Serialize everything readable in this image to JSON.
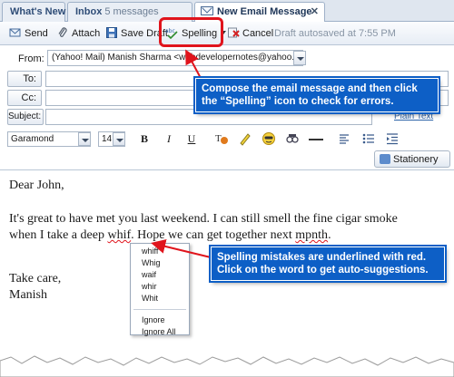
{
  "tabs": [
    {
      "label": "What's New"
    },
    {
      "label": "Inbox",
      "badge": "5 messages"
    },
    {
      "label": "New Email Message"
    }
  ],
  "toolbar": {
    "send": "Send",
    "attach": "Attach",
    "save_draft": "Save Draft",
    "spelling": "Spelling",
    "cancel": "Cancel",
    "draft_status": "Draft autosaved at 7:55 PM"
  },
  "header": {
    "from_label": "From:",
    "from_value": "(Yahoo! Mail) Manish Sharma <webdevelopernotes@yahoo.com>",
    "to_label": "To:",
    "cc_label": "Cc:",
    "subject_label": "Subject:",
    "plain_text_link": "Plain Text"
  },
  "format_toolbar": {
    "font": "Garamond",
    "size": "14",
    "bold": "B",
    "italic": "I",
    "underline": "U",
    "stationery": "Stationery"
  },
  "message": {
    "greeting": "Dear John,",
    "line1": "It's great to have met you last weekend. I can still smell the fine cigar smoke",
    "line2_before": "when I take a deep ",
    "misspelled1": "whif",
    "line2_middle": ". Hope we can get together next ",
    "misspelled2": "mpnth",
    "line2_after": ".",
    "closing": "Take care,",
    "signature": "Manish"
  },
  "suggestions_menu": {
    "items": [
      "whiff",
      "Whig",
      "waif",
      "whir",
      "Whit"
    ],
    "actions": [
      "Ignore",
      "Ignore All"
    ]
  },
  "callouts": {
    "spelling_tip": "Compose the email message and then click the “Spelling” icon to check for errors.",
    "underline_tip": "Spelling mistakes are underlined with red. Click on the word to get auto-suggestions."
  },
  "colors": {
    "callout_bg": "#0d5fc6",
    "highlight": "#e0141c",
    "link": "#2d63a8"
  }
}
